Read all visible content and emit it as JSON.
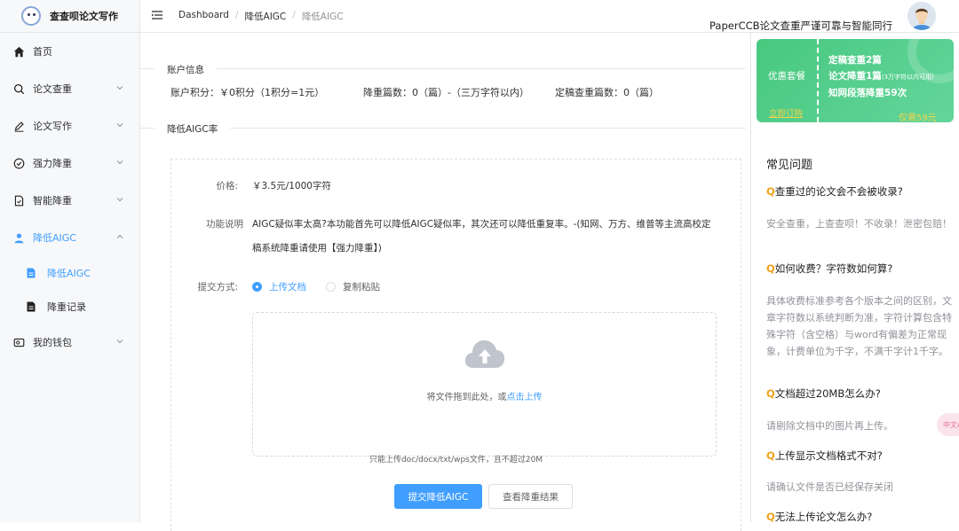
{
  "app": {
    "title": "查查呗论文写作"
  },
  "sidebar": {
    "items": [
      {
        "label": "首页",
        "icon": "home-icon"
      },
      {
        "label": "论文查重",
        "icon": "search-icon"
      },
      {
        "label": "论文写作",
        "icon": "pen-icon"
      },
      {
        "label": "强力降重",
        "icon": "check-circle-icon"
      },
      {
        "label": "智能降重",
        "icon": "document-icon"
      },
      {
        "label": "降低AIGC",
        "icon": "user-icon"
      },
      {
        "label": "我的钱包",
        "icon": "wallet-icon"
      }
    ],
    "subitems": [
      {
        "label": "降低AIGC",
        "icon": "file-icon"
      },
      {
        "label": "降重记录",
        "icon": "file-icon"
      }
    ]
  },
  "header": {
    "breadcrumb": [
      "Dashboard",
      "降低AIGC",
      "降低AIGC"
    ],
    "sep": "/",
    "slogan": "PaperCCB论文查重严谨可靠与智能同行"
  },
  "account": {
    "section_title": "账户信息",
    "points": "账户积分：￥0积分（1积分=1元）",
    "reduce": "降重篇数：0（篇）-（三万字符以内）",
    "check": "定稿查重篇数：0（篇）"
  },
  "aigc": {
    "section_title": "降低AIGC率",
    "price_label": "价格:",
    "price_value": "￥3.5元/1000字符",
    "desc_label": "功能说明",
    "desc_line1": "AIGC疑似率太高?本功能首先可以降低AIGC疑似率，其次还可以降低重复率。-(知网、万方、维普等主流高校定",
    "desc_line2": "稿系统降重请使用【强力降重】)",
    "submit_label": "提交方式:",
    "radio_upload": "上传文档",
    "radio_paste": "复制粘贴",
    "upload_text": "将文件拖到此处，或",
    "upload_link": "点击上传",
    "tip": "只能上传doc/docx/txt/wps文件，且不超过20M",
    "btn_submit": "提交降低AIGC",
    "btn_result": "查看降重结果"
  },
  "promo": {
    "title": "优惠套餐",
    "button": "立即订购",
    "line1": "定稿查重2篇",
    "line2": "论文降重1篇",
    "line2_small": "(3万字符以内可用)",
    "line3": "知网段落降重59次",
    "price": "仅需59元"
  },
  "faq": {
    "title": "常见问题",
    "q_mark": "Q",
    "items": [
      {
        "q": "查重过的论文会不会被收录?",
        "a": "安全查重，上查查呗！不收录！泄密包赔！"
      },
      {
        "q": "如何收费？字符数如何算?",
        "a": "具体收费标准参考各个版本之间的区别，文章字符数以系统判断为准，字符计算包含特殊字符（含空格）与word有偏差为正常现象，计费单位为千字，不满千字计1千字。"
      },
      {
        "q": "文档超过20MB怎么办?",
        "a": "请剔除文档中的图片再上传。"
      },
      {
        "q": "上传显示文档格式不对?",
        "a": "请确认文件是否已经保存关闭"
      },
      {
        "q": "无法上传论文怎么办?",
        "a": ""
      }
    ]
  },
  "float": {
    "label": "中文A"
  },
  "colors": {
    "accent": "#409eff",
    "promo": "#52cc8a",
    "qmark": "#f0a21a"
  }
}
